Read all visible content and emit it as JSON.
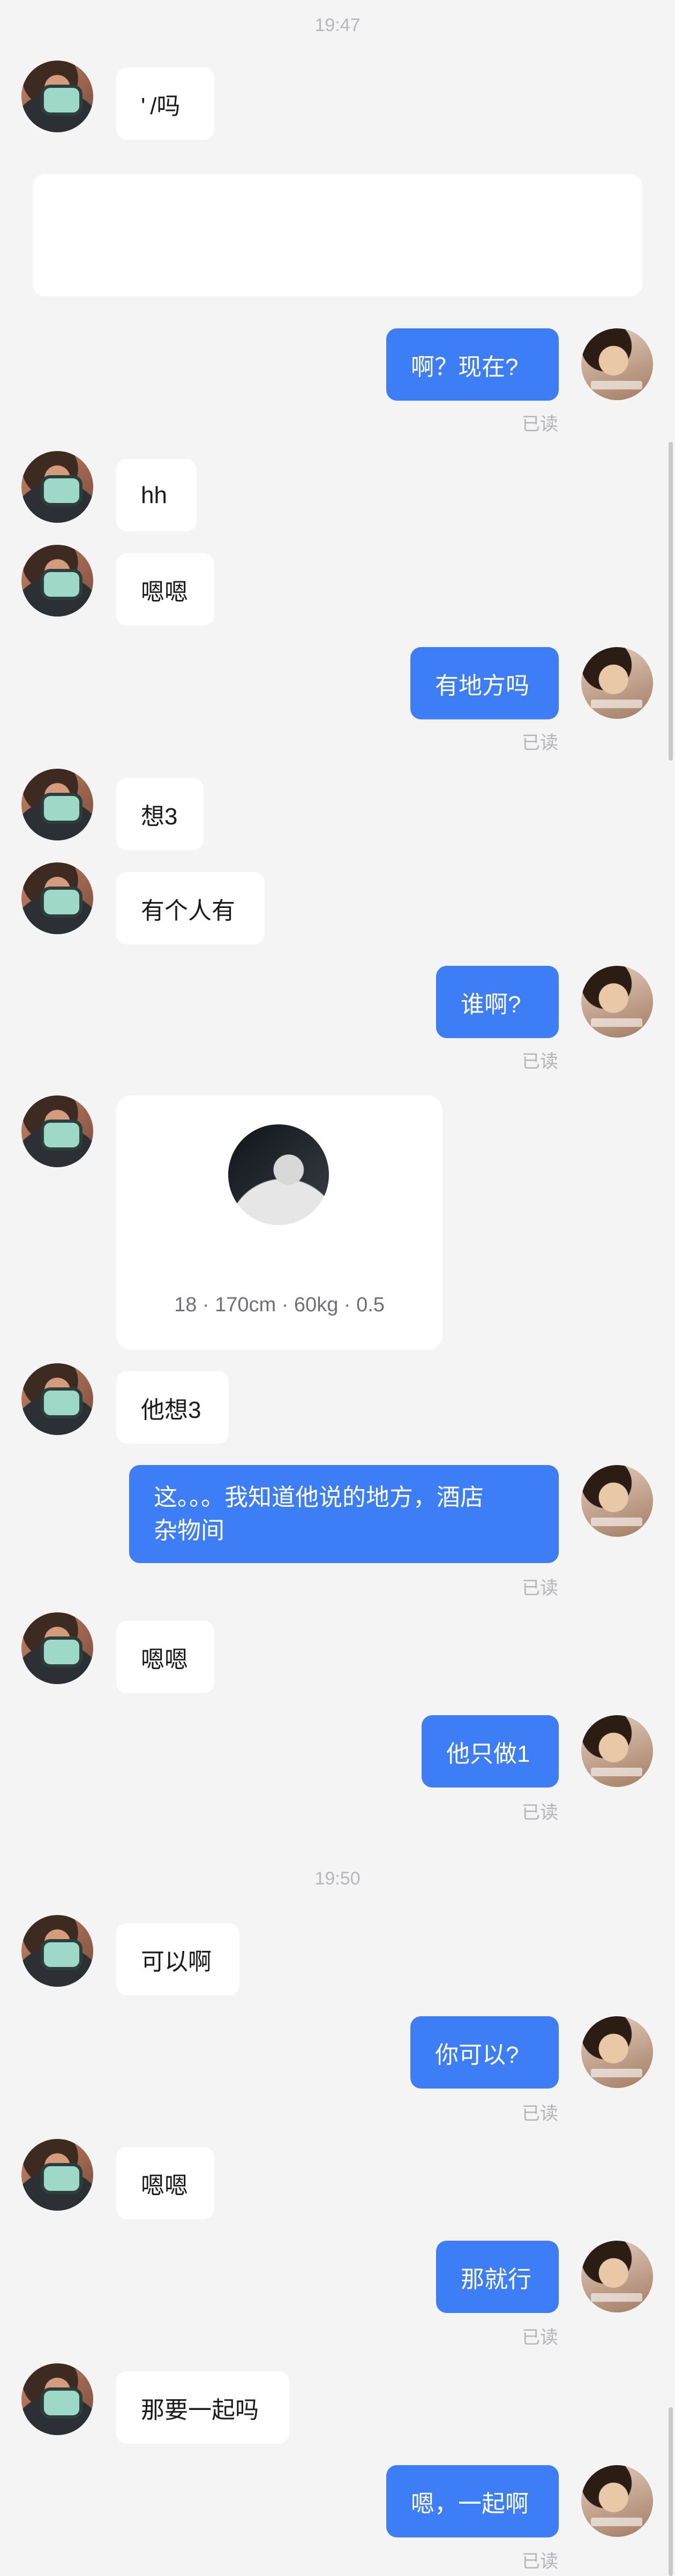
{
  "timestamps": [
    "19:47",
    "19:50"
  ],
  "read_label": "已读",
  "messages": {
    "m1": "' /吗",
    "m2": "啊？现在?",
    "m3": "hh",
    "m4": "嗯嗯",
    "m5": "有地方吗",
    "m6": "想3",
    "m7": "有个人有",
    "m8": "谁啊?",
    "m9_card_caption": "18 · 170cm · 60kg · 0.5",
    "m10": "他想3",
    "m11_line1": "这。。。我知道他说的地方，酒店",
    "m11_line2": "杂物间",
    "m12": "嗯嗯",
    "m13": "他只做1",
    "m14": "可以啊",
    "m15": "你可以?",
    "m16": "嗯嗯",
    "m17": "那就行",
    "m18": "那要一起吗",
    "m19": "嗯，一起啊"
  },
  "colors": {
    "background": "#f4f4f5",
    "outgoing_bubble": "#3d7ef6",
    "incoming_bubble": "#ffffff",
    "read_text": "#b5b5b8"
  }
}
